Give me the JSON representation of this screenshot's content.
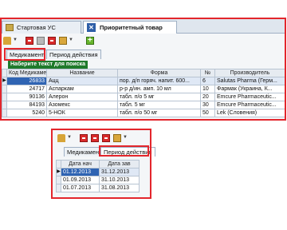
{
  "top": {
    "tabs": [
      {
        "label": "Стартовая УС"
      },
      {
        "label": "Приоритетный товар"
      }
    ],
    "subtabs": [
      "Медикамент",
      "Период действия"
    ],
    "search_hint": "Наберите текст для поиска",
    "columns": [
      "Код Медикамента",
      "Название",
      "Форма",
      "№",
      "Производитель"
    ],
    "rows": [
      {
        "code": "26833",
        "name": "Ацц",
        "form": "пор. д/п горяч. напит. 600...",
        "num": "6",
        "maker": "Salutas Pharma (Герм..."
      },
      {
        "code": "24717",
        "name": "Аспаркам",
        "form": "р-р д/ин. амп. 10 мл",
        "num": "10",
        "maker": "Фармак (Украина, К..."
      },
      {
        "code": "90136",
        "name": "Алерон",
        "form": "табл. п/о 5 мг",
        "num": "20",
        "maker": "Emcure Pharmaceutic..."
      },
      {
        "code": "84193",
        "name": "Азомекс",
        "form": "табл. 5 мг",
        "num": "30",
        "maker": "Emcure Pharmaceutic..."
      },
      {
        "code": "5240",
        "name": "5-НОК",
        "form": "табл. п/о 50 мг",
        "num": "50",
        "maker": "Lek (Словения)"
      }
    ]
  },
  "bottom": {
    "subtabs": [
      "Медикамент",
      "Период действия"
    ],
    "columns": [
      "Дата нач",
      "Дата зав"
    ],
    "rows": [
      {
        "start": "01.12.2013",
        "end": "31.12.2013"
      },
      {
        "start": "01.09.2013",
        "end": "31.10.2013"
      },
      {
        "start": "01.07.2013",
        "end": "31.08.2013"
      }
    ]
  },
  "colors": {
    "highlight_box": "#e3262c",
    "hint_bg": "#1f7a2b",
    "selected_cell": "#2f64b3"
  }
}
